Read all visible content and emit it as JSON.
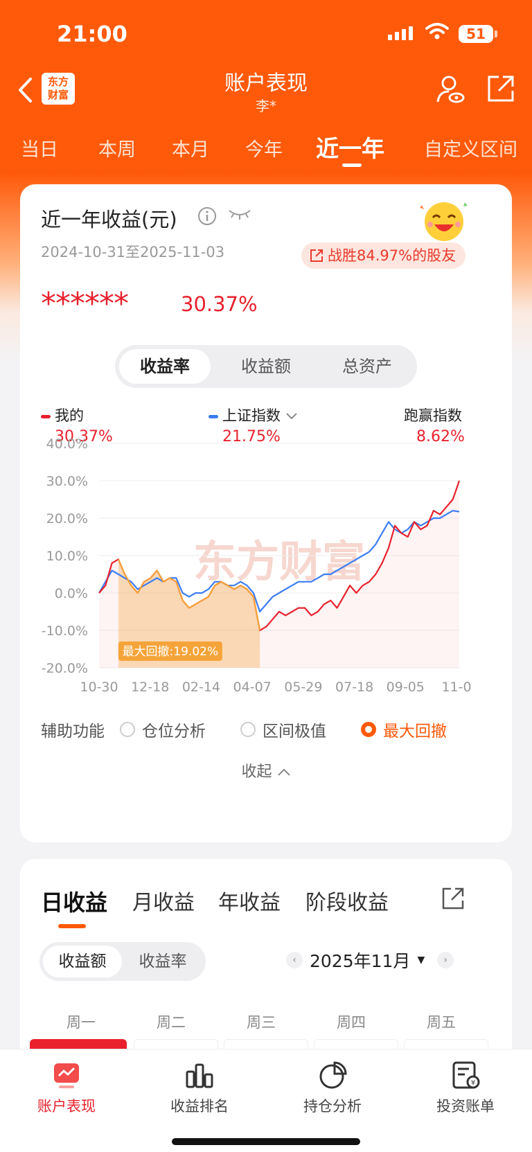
{
  "status": {
    "time": "21:00",
    "battery": "51"
  },
  "nav": {
    "title": "账户表现",
    "subtitle": "李*",
    "logo_line1": "东方",
    "logo_line2": "财富"
  },
  "period_tabs": [
    "当日",
    "本周",
    "本月",
    "今年",
    "近一年",
    "自定义区间"
  ],
  "summary": {
    "title": "近一年收益(元)",
    "date_range": "2024-10-31至2025-11-03",
    "beat_text": "战胜84.97%的股友",
    "masked_amount": "******",
    "return_pct": "30.37%"
  },
  "metric_tabs": [
    "收益率",
    "收益额",
    "总资产"
  ],
  "legend": {
    "mine_label": "我的",
    "mine_value": "30.37%",
    "index_label": "上证指数",
    "index_value": "21.75%",
    "beat_label": "跑赢指数",
    "beat_value": "8.62%"
  },
  "colors": {
    "accent": "#ff5a0a",
    "mine": "#e8212d",
    "index": "#3b7cf5",
    "drawdown": "#f5a43a"
  },
  "chart_data": {
    "type": "line",
    "x_ticks": [
      "10-30",
      "12-18",
      "02-14",
      "04-07",
      "05-29",
      "07-18",
      "09-05",
      "11-0"
    ],
    "y_ticks": [
      "40.0%",
      "30.0%",
      "20.0%",
      "10.0%",
      "0.0%",
      "-10.0%",
      "-20.0%"
    ],
    "ylim": [
      -20,
      40
    ],
    "watermark": "东方财富",
    "drawdown_label": "最大回撤:19.02%",
    "series": [
      {
        "name": "我的",
        "values": [
          0,
          2,
          8,
          9,
          5,
          2,
          0,
          3,
          4,
          6,
          3,
          4,
          3,
          -2,
          -4,
          -3,
          -2,
          -1,
          2,
          3,
          2,
          1,
          2,
          1,
          -1,
          -10,
          -9,
          -7,
          -5,
          -6,
          -5,
          -4,
          -4,
          -6,
          -5,
          -3,
          -2,
          -4,
          -1,
          2,
          0,
          2,
          3,
          5,
          8,
          12,
          18,
          16,
          15,
          19,
          17,
          18,
          22,
          21,
          23,
          25,
          30
        ]
      },
      {
        "name": "上证指数",
        "values": [
          0,
          3,
          6,
          5,
          4,
          3,
          1,
          2,
          3,
          4,
          3,
          4,
          4,
          0,
          -1,
          0,
          0,
          1,
          3,
          3,
          2,
          2,
          3,
          2,
          0,
          -5,
          -3,
          -1,
          0,
          1,
          2,
          3,
          3,
          3,
          4,
          5,
          5,
          6,
          7,
          8,
          9,
          10,
          11,
          13,
          16,
          19,
          17,
          16,
          17,
          19,
          18,
          19,
          20,
          20,
          21,
          22,
          21.75
        ]
      }
    ],
    "drawdown": {
      "start_index": 3,
      "end_index": 25
    }
  },
  "aux": {
    "label": "辅助功能",
    "options": [
      "仓位分析",
      "区间极值",
      "最大回撤"
    ],
    "collapse": "收起"
  },
  "section2": {
    "tabs": [
      "日收益",
      "月收益",
      "年收益",
      "阶段收益"
    ],
    "seg": [
      "收益额",
      "收益率"
    ],
    "month": "2025年11月",
    "weekdays": [
      "周一",
      "周二",
      "周三",
      "周四",
      "周五"
    ]
  },
  "bottom_nav": [
    "账户表现",
    "收益排名",
    "持仓分析",
    "投资账单"
  ]
}
